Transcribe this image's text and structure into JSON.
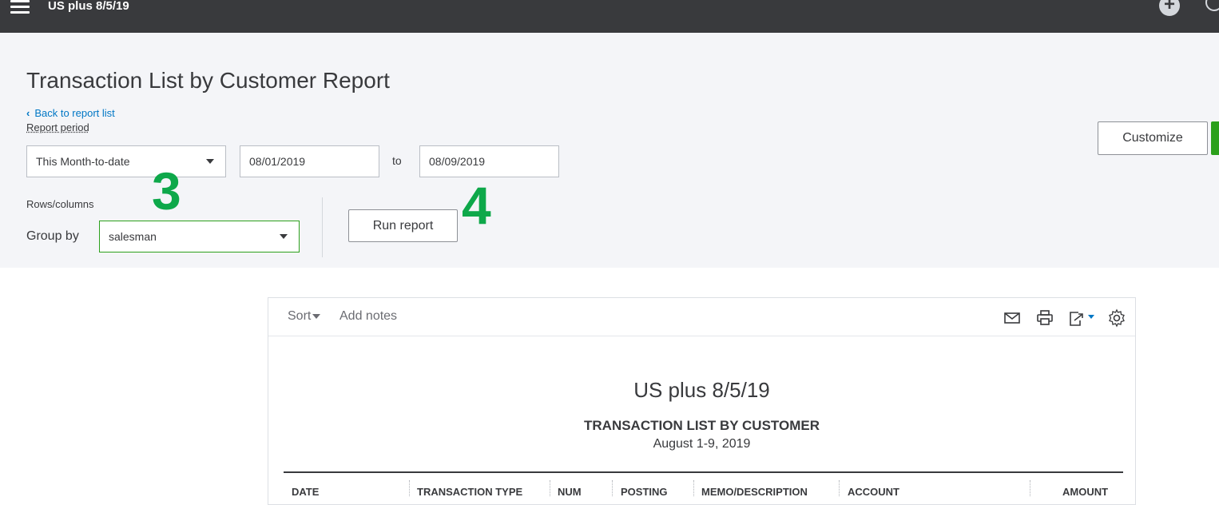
{
  "topbar": {
    "company_name": "US plus 8/5/19"
  },
  "page": {
    "title": "Transaction List by Customer Report",
    "back_link": "Back to report list",
    "report_period_label": "Report period",
    "period_select": "This Month-to-date",
    "date_from": "08/01/2019",
    "to_label": "to",
    "date_to": "08/09/2019",
    "rows_columns_label": "Rows/columns",
    "group_by_label": "Group by",
    "group_by_value": "salesman",
    "run_report_label": "Run report",
    "customize_label": "Customize"
  },
  "annotations": {
    "step3": "3",
    "step4": "4"
  },
  "report": {
    "sort_label": "Sort",
    "add_notes_label": "Add notes",
    "company": "US plus 8/5/19",
    "title": "TRANSACTION LIST BY CUSTOMER",
    "date_range": "August 1-9, 2019",
    "columns": [
      "DATE",
      "TRANSACTION TYPE",
      "NUM",
      "POSTING",
      "MEMO/DESCRIPTION",
      "ACCOUNT",
      "AMOUNT"
    ]
  },
  "icons": [
    "menu-icon",
    "plus-icon",
    "search-icon",
    "chevron-left-icon",
    "caret-down-icon",
    "email-icon",
    "print-icon",
    "export-icon",
    "gear-icon"
  ],
  "colors": {
    "topbar": "#393a3d",
    "panel": "#f4f5f8",
    "accent_green": "#2ca01c",
    "annotation_green": "#0ea84a",
    "link_blue": "#0077c5"
  }
}
